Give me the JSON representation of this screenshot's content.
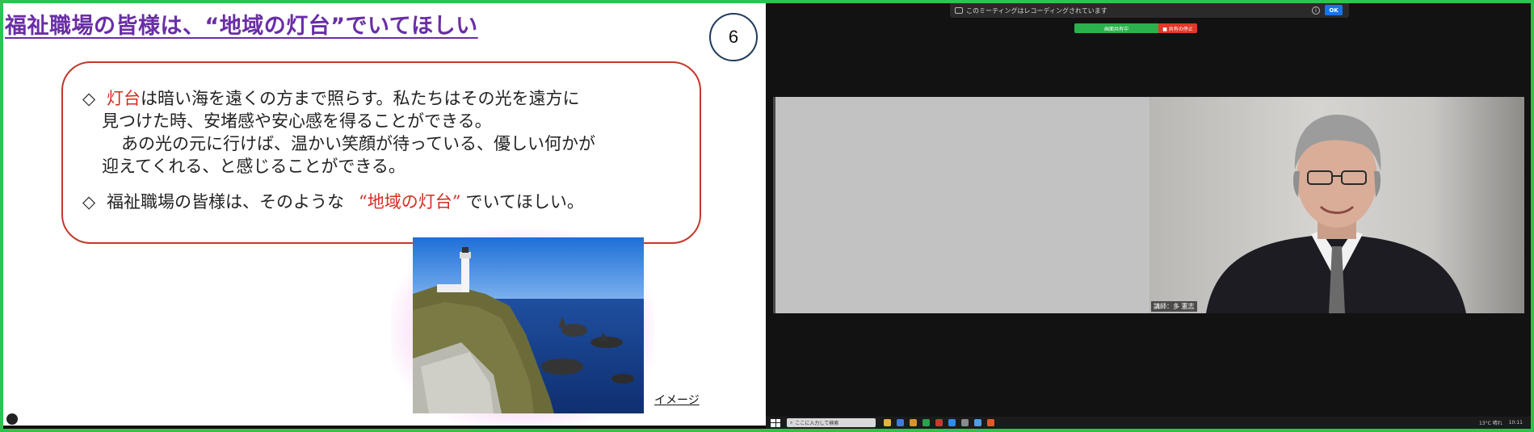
{
  "slide": {
    "title": "福祉職場の皆様は、“地域の灯台”でいてほしい",
    "page_number": "6",
    "bullets": [
      {
        "symbol": "◇",
        "line1_highlight": "灯台",
        "line1_rest": "は暗い海を遠くの方まで照らす。私たちはその光を遠方に",
        "line2": "見つけた時、安堵感や安心感を得ることができる。",
        "line3": "あの光の元に行けば、温かい笑顔が待っている、優しい何かが",
        "line4": "迎えてくれる、と感じることができる。"
      },
      {
        "symbol": "◇",
        "text_before": "福祉職場の皆様は、そのような",
        "highlight": "“地域の灯台”",
        "text_after": "でいてほしい。"
      }
    ],
    "image_caption": "イメージ"
  },
  "meeting": {
    "recording_banner": "このミーティングはレコーディングされています",
    "ok_label": "OK",
    "sharing_label": "画面共有中",
    "stop_share_label": "■ 共有の停止",
    "speaker_name": "講師：多 憲志"
  },
  "taskbar": {
    "search_placeholder": "ここに入力して検索",
    "weather": "13°C 晴れ",
    "time": "10:11"
  },
  "colors": {
    "share_border": "#2fc24f",
    "title_purple": "#6a2ea5",
    "highlight_red": "#d62d1e",
    "box_border": "#c0392b"
  },
  "icons": [
    "record-icon",
    "info-icon",
    "windows-start-icon",
    "search-icon"
  ]
}
